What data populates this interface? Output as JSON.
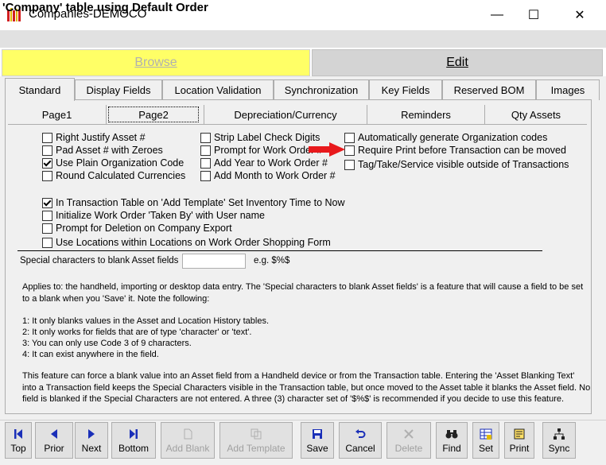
{
  "window": {
    "title": "Companies-DEMOCO",
    "minimize_glyph": "—",
    "maximize_glyph": "☐",
    "close_glyph": "✕"
  },
  "header": {
    "title": "'Company' table using Default Order"
  },
  "modes": {
    "browse": "Browse",
    "edit": "Edit"
  },
  "main_tabs": [
    "Standard",
    "Display Fields",
    "Location Validation",
    "Synchronization",
    "Key Fields",
    "Reserved BOM",
    "Images"
  ],
  "sub_tabs": [
    "Page1",
    "Page2",
    "Depreciation/Currency",
    "Reminders",
    "Qty Assets"
  ],
  "checkboxes": {
    "right_justify": {
      "label": "Right Justify Asset #",
      "checked": false
    },
    "pad_asset": {
      "label": "Pad Asset # with Zeroes",
      "checked": false
    },
    "plain_org": {
      "label": "Use Plain Organization Code",
      "checked": true
    },
    "round_currencies": {
      "label": "Round Calculated Currencies",
      "checked": false
    },
    "strip_label": {
      "label": "Strip Label Check Digits",
      "checked": false
    },
    "prompt_work_order": {
      "label": "Prompt for Work Order #",
      "checked": false
    },
    "add_year": {
      "label": "Add Year to Work Order #",
      "checked": false
    },
    "add_month": {
      "label": "Add Month to Work Order #",
      "checked": false
    },
    "auto_org_codes": {
      "label": "Automatically generate Organization codes",
      "checked": false
    },
    "require_print": {
      "label": "Require Print before Transaction can be moved",
      "checked": false
    },
    "tag_take": {
      "label": "Tag/Take/Service visible outside of Transactions",
      "checked": false
    },
    "template_inventory": {
      "label": "In Transaction Table on 'Add Template' Set Inventory Time to Now",
      "checked": true
    },
    "init_taken_by": {
      "label": "Initialize Work Order 'Taken By' with User name",
      "checked": false
    },
    "prompt_deletion": {
      "label": "Prompt for Deletion on Company Export",
      "checked": false
    },
    "locations_within": {
      "label": "Use Locations within Locations on Work Order Shopping Form",
      "checked": false
    }
  },
  "special": {
    "label": "Special characters to blank Asset fields",
    "value": "",
    "example": "e.g. $%$"
  },
  "description": {
    "para1_line1": "Applies to: the handheld, importing or desktop data entry.  The 'Special characters to blank Asset fields' is a feature that will cause a field to be set",
    "para1_line2": "to a blank when you 'Save' it.  Note the following:",
    "note1": "1: It only blanks values in the Asset and Location History tables.",
    "note2": "2: It only works for fields that are of type 'character' or 'text'.",
    "note3": "3: You can only use Code 3 of 9 characters.",
    "note4": "4: It can exist anywhere in the field.",
    "para2_line1": "This feature can force a blank value into an Asset field from a Handheld device or from the Transaction table.  Entering the 'Asset Blanking Text'",
    "para2_line2": "into a Transaction field keeps the Special Characters visible in the Transaction table, but once moved to the Asset table it blanks the Asset field. No",
    "para2_line3": "field is blanked if the Special Characters are not entered. A three (3) character set of '$%$' is recommended if you decide to use this feature."
  },
  "toolbar": {
    "top": "Top",
    "prior": "Prior",
    "next": "Next",
    "bottom": "Bottom",
    "add_blank": "Add Blank",
    "add_template": "Add Template",
    "save": "Save",
    "cancel": "Cancel",
    "delete": "Delete",
    "find": "Find",
    "set": "Set",
    "print": "Print",
    "sync": "Sync"
  },
  "colors": {
    "browse_bg": "#ffff66",
    "arrow": "#e8191c",
    "nav_blue": "#1a2fb8"
  }
}
